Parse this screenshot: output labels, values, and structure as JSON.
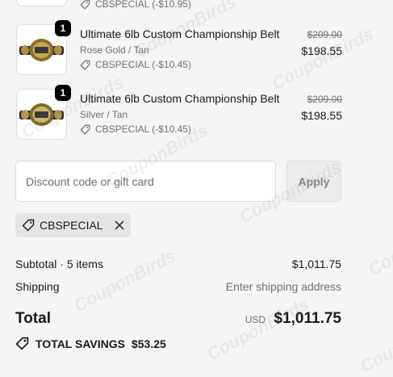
{
  "cart": {
    "partial_discount": "CBSPECIAL (-$10.95)",
    "items": [
      {
        "quantity": "1",
        "title": "Ultimate 6lb Custom Championship Belt",
        "variant": "Rose Gold / Tan",
        "discount": "CBSPECIAL (-$10.45)",
        "original_price": "$209.00",
        "price": "$198.55"
      },
      {
        "quantity": "1",
        "title": "Ultimate 6lb Custom Championship Belt",
        "variant": "Silver / Tan",
        "discount": "CBSPECIAL (-$10.45)",
        "original_price": "$209.00",
        "price": "$198.55"
      }
    ]
  },
  "discount_form": {
    "placeholder": "Discount code or gift card",
    "apply_label": "Apply"
  },
  "applied_code": "CBSPECIAL",
  "summary": {
    "subtotal_label": "Subtotal · 5 items",
    "subtotal_value": "$1,011.75",
    "shipping_label": "Shipping",
    "shipping_value": "Enter shipping address",
    "total_label": "Total",
    "currency": "USD",
    "total_value": "$1,011.75",
    "savings_label": "TOTAL SAVINGS",
    "savings_value": "$53.25"
  },
  "watermark": "CouponBirds",
  "colors": {
    "background": "#f5f5f5",
    "text": "#1a1a1a",
    "muted": "#707070",
    "badge": "#000000"
  },
  "icons": [
    "tag-icon",
    "close-icon",
    "savings-tag-icon",
    "belt-image"
  ]
}
